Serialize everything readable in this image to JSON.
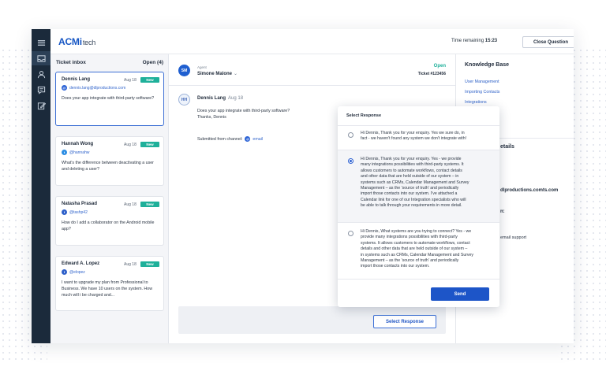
{
  "app": {
    "logo_main": "ACMi",
    "logo_sub": "tech",
    "time_remaining_label": "Time remaining",
    "time_remaining_value": "15:23",
    "close_button": "Close Question"
  },
  "sidebar": {
    "icons": [
      "menu-icon",
      "inbox-icon",
      "user-icon",
      "chat-icon",
      "edit-icon"
    ],
    "active": "inbox-icon"
  },
  "inbox": {
    "title": "Ticket inbox",
    "count": "Open (4)",
    "tickets": [
      {
        "name": "Dennis Lang",
        "date": "Aug 18",
        "badge": "New",
        "channel": "email",
        "handle": "dennis.lang@dlproductions.com",
        "body": "Does your app integrate with third-party software?"
      },
      {
        "name": "Hannah Wong",
        "date": "Aug 18",
        "badge": "New",
        "channel": "twitter",
        "handle": "@hannahw",
        "body": "What's the difference between deactivating a user and deleting a user?"
      },
      {
        "name": "Natasha Prasad",
        "date": "Aug 18",
        "badge": "New",
        "channel": "facebook",
        "handle": "@tashp42",
        "body": "How do I add a collaborator on the Android mobile app?"
      },
      {
        "name": "Edward A. Lopez",
        "date": "Aug 18",
        "badge": "New",
        "channel": "facebook",
        "handle": "@elopez",
        "body": "I want to upgrade my plan from Professional to Business. We have 10 users on the system. How much will i be charged and..."
      }
    ]
  },
  "conversation": {
    "agent_initials": "SM",
    "agent_label": "Agent",
    "agent_name": "Simone Malone",
    "status": "Open",
    "ticket_number": "Ticket #123456",
    "message": {
      "initials": "HH",
      "name": "Dennis Lang",
      "date": "Aug 18",
      "line1": "Does your app integrate with third-party software?",
      "line2": "Thanks, Dennis",
      "submitted_label": "Submitted from channel:",
      "submitted_channel": "email"
    },
    "select_button": "Select Response"
  },
  "knowledge_base": {
    "title": "Knowledge Base",
    "links": [
      "User Management",
      "Importing Contacts",
      "Integrations"
    ],
    "fragments": [
      "etails",
      "dlproductions.comts.com",
      "n:",
      "email support"
    ]
  },
  "modal": {
    "title": "Select Response",
    "options": [
      {
        "selected": false,
        "lines": [
          "Hi Dennis, Thank you for your enquiry. Yes we sure do, in",
          "fact - we haven't found any system we don't integrate with!"
        ]
      },
      {
        "selected": true,
        "lines": [
          "Hi Dennis, Thank you for your enquiry. Yes - we provide",
          "many integrations possibilities with third-party systems. It",
          "allows customers to automate workflows, contact details",
          "and other data that are held outside of our system – in",
          "systems such as CRMs, Calendar Management and Survey",
          "Management – as the 'source of truth' and periodically",
          "import those contacts into our system. I've attached a",
          "Calendar link for one of our Integration specialists who will",
          "be able to talk through your requirements in more detail."
        ]
      },
      {
        "selected": false,
        "lines": [
          "Hi Dennis, What systems are you trying to connect? Yes - we",
          "provide many integrations possibilities with third-party",
          "systems. It allows customers to automate workflows, contact",
          "details and other data that are held outside of our system –",
          "in systems such as CRMs, Calendar Management and Survey",
          "Management – as the 'source of truth' and periodically",
          "import those contacts into our system."
        ]
      }
    ],
    "send_button": "Send"
  }
}
